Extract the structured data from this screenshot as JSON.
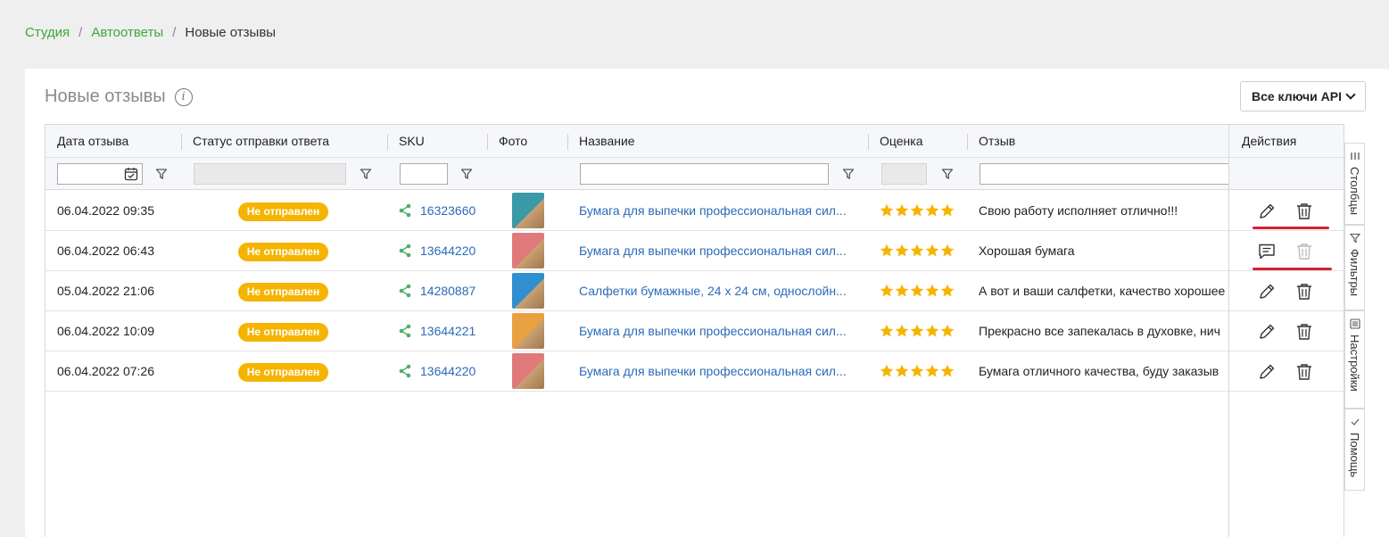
{
  "breadcrumb": {
    "studio": "Студия",
    "sep1": "/",
    "autoreplies": "Автоответы",
    "sep2": "/",
    "current": "Новые отзывы"
  },
  "page": {
    "title": "Новые отзывы",
    "info": "i"
  },
  "api_select": {
    "label": "Все ключи API"
  },
  "columns": {
    "date": "Дата отзыва",
    "status": "Статус отправки ответа",
    "sku": "SKU",
    "photo": "Фото",
    "name": "Название",
    "rating": "Оценка",
    "review": "Отзыв",
    "actions": "Действия"
  },
  "rows": [
    {
      "date": "06.04.2022 09:35",
      "status": "Не отправлен",
      "sku": "16323660",
      "name": "Бумага для выпечки профессиональная сил...",
      "rating": 5,
      "review": "Свою работу исполняет отлично!!!",
      "photo_color": "#3a9aa8",
      "first_action": "edit",
      "delete_dim": false
    },
    {
      "date": "06.04.2022 06:43",
      "status": "Не отправлен",
      "sku": "13644220",
      "name": "Бумага для выпечки профессиональная сил...",
      "rating": 5,
      "review": "Хорошая бумага",
      "photo_color": "#e07a7a",
      "first_action": "comment",
      "delete_dim": true
    },
    {
      "date": "05.04.2022 21:06",
      "status": "Не отправлен",
      "sku": "14280887",
      "name": "Салфетки бумажные, 24 x 24 см, однослойн...",
      "rating": 5,
      "review": "А вот и ваши салфетки, качество хорошее",
      "photo_color": "#2f8fd0",
      "first_action": "edit",
      "delete_dim": false
    },
    {
      "date": "06.04.2022 10:09",
      "status": "Не отправлен",
      "sku": "13644221",
      "name": "Бумага для выпечки профессиональная сил...",
      "rating": 5,
      "review": "Прекрасно все запекалась в духовке, нич",
      "photo_color": "#e8a040",
      "first_action": "edit",
      "delete_dim": false
    },
    {
      "date": "06.04.2022 07:26",
      "status": "Не отправлен",
      "sku": "13644220",
      "name": "Бумага для выпечки профессиональная сил...",
      "rating": 5,
      "review": "Бумага отличного качества, буду заказыв",
      "photo_color": "#e07a7a",
      "first_action": "edit",
      "delete_dim": false
    }
  ],
  "side_tabs": {
    "columns": "Столбцы",
    "filters": "Фильтры",
    "settings": "Настройки",
    "help": "Помощь"
  },
  "colors": {
    "accent_green": "#3aa93a",
    "link_blue": "#2a6bb8",
    "badge": "#f5b400",
    "star": "#f5b400",
    "highlight_red": "#d62030"
  }
}
